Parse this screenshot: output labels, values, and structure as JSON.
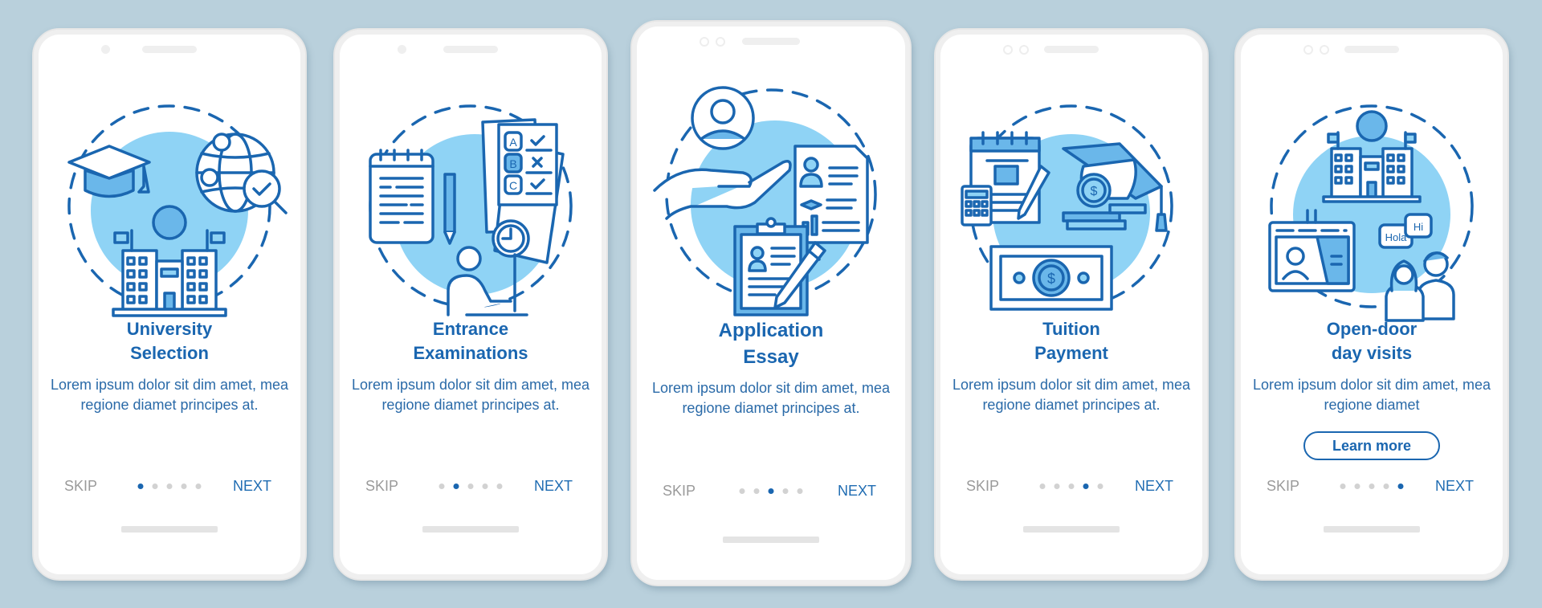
{
  "colors": {
    "background": "#b9d0dc",
    "accent": "#1a66b0",
    "illustration_circle": "#8fd3f5",
    "inactive_dot": "#d2d2d2",
    "skip_text": "#9a9a9a"
  },
  "screens": [
    {
      "title_line1": "University",
      "title_line2": "Selection",
      "description": "Lorem ipsum dolor sit dim amet, mea regione diamet principes at.",
      "skip_label": "SKIP",
      "next_label": "NEXT",
      "page_index": 1,
      "page_count": 5,
      "icon": "university-selection-icon"
    },
    {
      "title_line1": "Entrance",
      "title_line2": "Examinations",
      "description": "Lorem ipsum dolor sit dim amet, mea regione diamet principes at.",
      "skip_label": "SKIP",
      "next_label": "NEXT",
      "page_index": 2,
      "page_count": 5,
      "icon": "entrance-exam-icon",
      "exam_options": [
        "A",
        "B",
        "C"
      ]
    },
    {
      "title_line1": "Application",
      "title_line2": "Essay",
      "description": "Lorem ipsum dolor sit dim amet, mea regione diamet principes at.",
      "skip_label": "SKIP",
      "next_label": "NEXT",
      "page_index": 3,
      "page_count": 5,
      "icon": "application-essay-icon"
    },
    {
      "title_line1": "Tuition",
      "title_line2": "Payment",
      "description": "Lorem ipsum dolor sit dim amet, mea regione diamet principes at.",
      "skip_label": "SKIP",
      "next_label": "NEXT",
      "page_index": 4,
      "page_count": 5,
      "icon": "tuition-payment-icon",
      "currency_symbol": "$"
    },
    {
      "title_line1": "Open-door",
      "title_line2": "day visits",
      "description": "Lorem ipsum dolor sit dim amet, mea regione diamet",
      "skip_label": "SKIP",
      "next_label": "NEXT",
      "learn_more_label": "Learn more",
      "page_index": 5,
      "page_count": 5,
      "icon": "open-door-visits-icon",
      "speech_bubbles": [
        "Hola",
        "Hi"
      ]
    }
  ]
}
